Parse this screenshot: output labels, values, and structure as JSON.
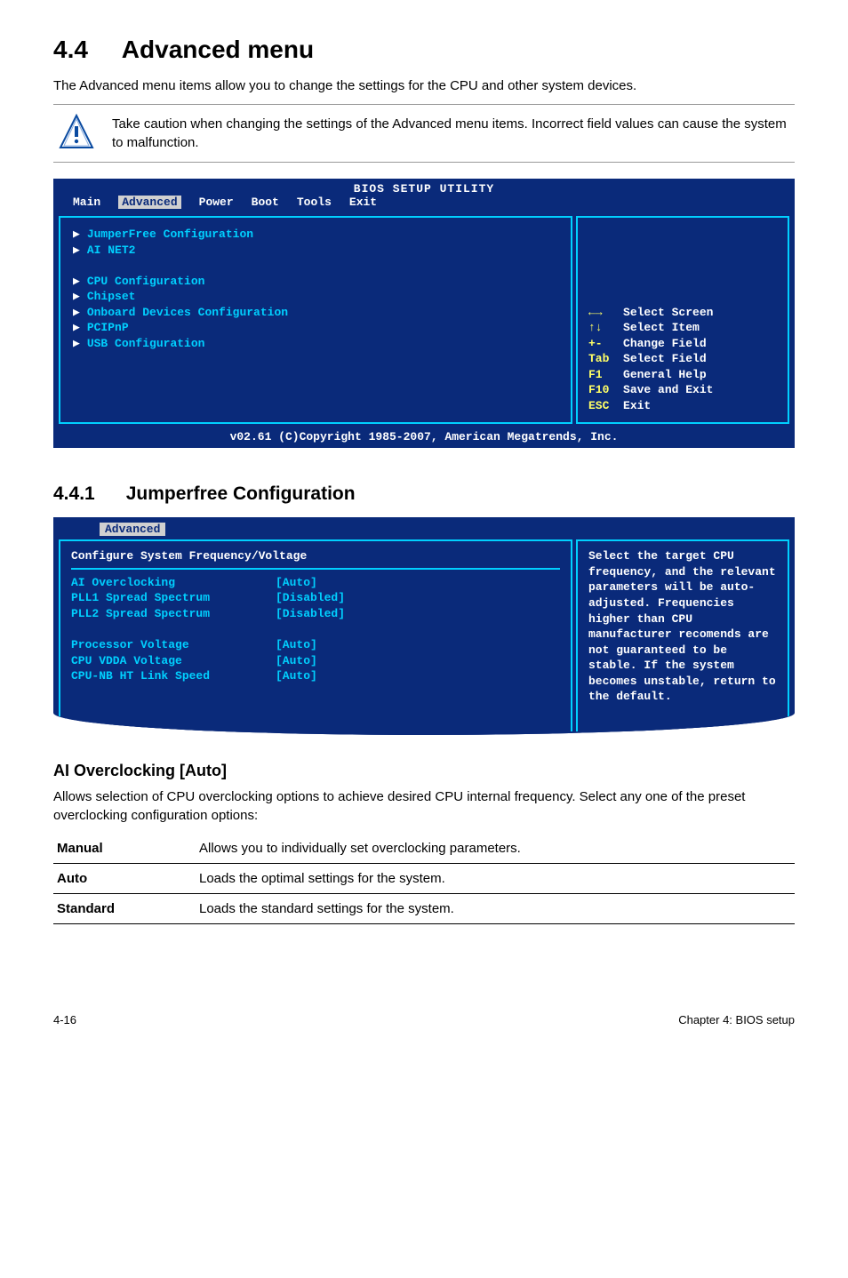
{
  "section": {
    "number": "4.4",
    "title": "Advanced menu"
  },
  "intro": "The Advanced menu items allow you to change the settings for the CPU and other system devices.",
  "caution": "Take caution when changing the settings of the Advanced menu items. Incorrect field values can cause the system to malfunction.",
  "bios1": {
    "title": "BIOS SETUP UTILITY",
    "tabs": [
      "Main",
      "Advanced",
      "Power",
      "Boot",
      "Tools",
      "Exit"
    ],
    "active_tab": "Advanced",
    "items_group1": [
      "JumperFree Configuration",
      "AI NET2"
    ],
    "items_group2": [
      "CPU Configuration",
      "Chipset",
      "Onboard Devices Configuration",
      "PCIPnP",
      "USB Configuration"
    ],
    "help": [
      {
        "k": "←→",
        "v": "Select Screen"
      },
      {
        "k": "↑↓",
        "v": "Select Item"
      },
      {
        "k": "+-",
        "v": "Change Field"
      },
      {
        "k": "Tab",
        "v": "Select Field"
      },
      {
        "k": "F1",
        "v": "General Help"
      },
      {
        "k": "F10",
        "v": "Save and Exit"
      },
      {
        "k": "ESC",
        "v": "Exit"
      }
    ],
    "copyright": "v02.61 (C)Copyright 1985-2007, American Megatrends, Inc."
  },
  "subsection": {
    "number": "4.4.1",
    "title": "Jumperfree Configuration"
  },
  "bios2": {
    "tab": "Advanced",
    "header": "Configure System Frequency/Voltage",
    "rows": [
      {
        "lab": "AI Overclocking",
        "val": "[Auto]"
      },
      {
        "lab": "PLL1 Spread Spectrum",
        "val": "[Disabled]"
      },
      {
        "lab": "PLL2 Spread Spectrum",
        "val": "[Disabled]"
      },
      {
        "lab": "",
        "val": ""
      },
      {
        "lab": "Processor Voltage",
        "val": "[Auto]"
      },
      {
        "lab": "CPU VDDA Voltage",
        "val": "[Auto]"
      },
      {
        "lab": "CPU-NB HT Link Speed",
        "val": "[Auto]"
      }
    ],
    "right": "Select the target CPU frequency, and the relevant parameters will be auto-adjusted. Frequencies higher than CPU manufacturer recomends are not guaranteed to be stable. If the system becomes unstable, return to the default."
  },
  "ai_over": {
    "heading": "AI Overclocking [Auto]",
    "desc": "Allows selection of CPU overclocking options to achieve desired CPU internal frequency. Select any one of the preset overclocking configuration options:",
    "rows": [
      {
        "k": "Manual",
        "v": "Allows you to individually set overclocking parameters."
      },
      {
        "k": "Auto",
        "v": "Loads the optimal settings for the system."
      },
      {
        "k": "Standard",
        "v": "Loads the standard settings for the system."
      }
    ]
  },
  "footer": {
    "left": "4-16",
    "right": "Chapter 4: BIOS setup"
  }
}
